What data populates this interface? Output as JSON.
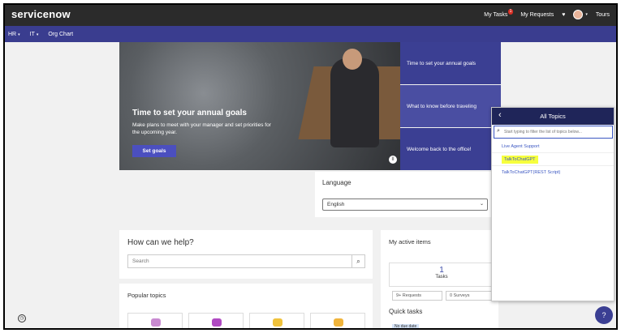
{
  "header": {
    "logo": "servicenow",
    "nav": {
      "my_tasks": "My Tasks",
      "my_tasks_badge": "1",
      "my_requests": "My Requests",
      "heart_icon": "heart-icon",
      "tours": "Tours"
    }
  },
  "subnav": {
    "items": [
      {
        "label": "HR",
        "caret": "▾"
      },
      {
        "label": "IT",
        "caret": "▾"
      },
      {
        "label": "Org Chart"
      }
    ]
  },
  "hero": {
    "title": "Time to set your annual goals",
    "text": "Make plans to meet with your manager and set priorities for the upcoming year.",
    "button": "Set goals",
    "pause": "II"
  },
  "slides": [
    "Time to set your annual goals",
    "What to know before traveling",
    "Welcome back to the office!"
  ],
  "language": {
    "title": "Language",
    "selected": "English"
  },
  "help": {
    "title": "How can we help?",
    "search_placeholder": "Search"
  },
  "popular": {
    "title": "Popular topics"
  },
  "active_items": {
    "title": "My active items",
    "tasks_count": "1",
    "tasks_label": "Tasks",
    "requests_pill": "9+ Requests",
    "surveys_pill": "0 Surveys",
    "quick_title": "Quick tasks",
    "due_label": "No due date"
  },
  "topics_panel": {
    "title": "All Topics",
    "search_placeholder": "Start typing to filter the list of topics below...",
    "items": [
      "Live Agent Support",
      "TalkToChatGPT",
      "TalkToChatGPT(REST Script)"
    ]
  },
  "colors": {
    "topbar": "#2b2b2b",
    "subnav": "#3a3d8f",
    "accent": "#3b57c2",
    "highlight": "#f6ff3d"
  }
}
